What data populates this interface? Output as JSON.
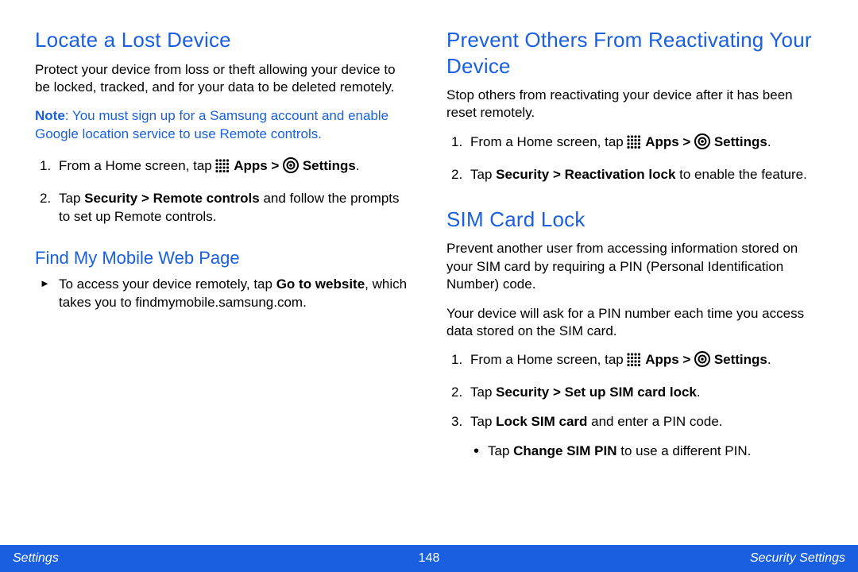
{
  "left": {
    "h1": "Locate a Lost Device",
    "intro": "Protect your device from loss or theft allowing your device to be locked, tracked, and for your data to be deleted remotely.",
    "note_label": "Note",
    "note_body": ": You must sign up for a Samsung account and enable Google location service to use Remote controls.",
    "step1_pre": "From a Home screen, tap ",
    "step1_apps": "Apps > ",
    "step1_settings": "Settings",
    "step1_post": ".",
    "step2_pre": "Tap ",
    "step2_bold": "Security > Remote controls",
    "step2_post": " and follow the prompts to set up Remote controls.",
    "h2": "Find My Mobile Web Page",
    "arrow_pre": "To access your device remotely, tap ",
    "arrow_bold": "Go to website",
    "arrow_mid": ", which takes you to ",
    "arrow_link": "findmymobile.samsung.com",
    "arrow_post": "."
  },
  "right": {
    "h1a": "Prevent Others From Reactivating Your Device",
    "intro_a": "Stop others from reactivating your device after it has been reset remotely.",
    "a_step1_pre": "From a Home screen, tap ",
    "a_step1_apps": "Apps > ",
    "a_step1_settings": "Settings",
    "a_step1_post": ".",
    "a_step2_pre": "Tap ",
    "a_step2_bold": "Security > Reactivation lock",
    "a_step2_post": " to enable the feature.",
    "h1b": "SIM Card Lock",
    "intro_b1": "Prevent another user from accessing information stored on your SIM card by requiring a PIN (Personal Identification Number) code.",
    "intro_b2": "Your device will ask for a PIN number each time you access data stored on the SIM card.",
    "b_step1_pre": "From a Home screen, tap ",
    "b_step1_apps": "Apps > ",
    "b_step1_settings": "Settings",
    "b_step1_post": ".",
    "b_step2_pre": "Tap ",
    "b_step2_bold": "Security > Set up SIM card lock",
    "b_step2_post": ".",
    "b_step3_pre": "Tap ",
    "b_step3_bold": "Lock SIM card",
    "b_step3_post": " and enter a PIN code.",
    "b_bullet_pre": "Tap ",
    "b_bullet_bold": "Change SIM PIN",
    "b_bullet_post": " to use a different PIN."
  },
  "footer": {
    "left": "Settings",
    "page": "148",
    "right": "Security Settings"
  }
}
